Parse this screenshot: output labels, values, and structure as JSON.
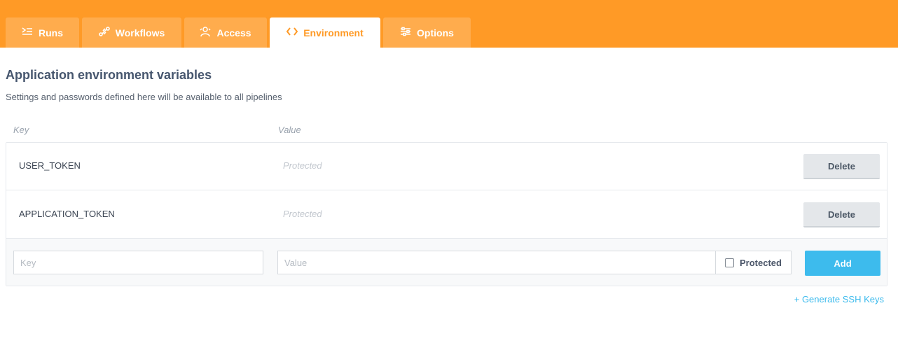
{
  "tabs": [
    {
      "label": "Runs",
      "icon": "runs-icon"
    },
    {
      "label": "Workflows",
      "icon": "workflows-icon"
    },
    {
      "label": "Access",
      "icon": "access-icon"
    },
    {
      "label": "Environment",
      "icon": "code-icon",
      "active": true
    },
    {
      "label": "Options",
      "icon": "options-icon"
    }
  ],
  "colors": {
    "brand": "#ff9a26",
    "accent": "#3dbbed"
  },
  "main": {
    "title": "Application environment variables",
    "subtitle": "Settings and passwords defined here will be available to all pipelines",
    "columns": {
      "key": "Key",
      "value": "Value"
    },
    "variables": [
      {
        "key": "USER_TOKEN",
        "value": "Protected",
        "action": "Delete"
      },
      {
        "key": "APPLICATION_TOKEN",
        "value": "Protected",
        "action": "Delete"
      }
    ],
    "new_variable": {
      "key_placeholder": "Key",
      "value_placeholder": "Value",
      "protected_label": "Protected",
      "protected_checked": false,
      "add_label": "Add"
    },
    "generate_ssh_label": "+ Generate SSH Keys"
  }
}
